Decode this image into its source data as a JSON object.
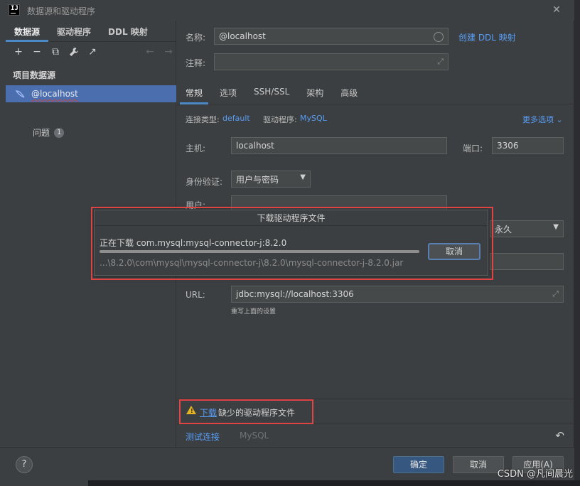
{
  "window": {
    "logo": "IJ",
    "title": "数据源和驱动程序",
    "close": "✕"
  },
  "left": {
    "tabs": [
      {
        "label": "数据源",
        "active": true
      },
      {
        "label": "驱动程序",
        "active": false
      },
      {
        "label": "DDL 映射",
        "active": false
      }
    ],
    "toolbar": {
      "add": "+",
      "remove": "−",
      "copy": "⧉",
      "settings": "🔧",
      "export": "↗",
      "back": "←",
      "forward": "→"
    },
    "group_label": "项目数据源",
    "datasource": "@localhost",
    "issues_label": "问题",
    "issues_count": "1"
  },
  "right": {
    "name_label": "名称:",
    "name_value": "@localhost",
    "create_ddl_link": "创建 DDL 映射",
    "comment_label": "注释:",
    "comment_value": "",
    "tabs": [
      {
        "label": "常规",
        "active": true
      },
      {
        "label": "选项",
        "active": false
      },
      {
        "label": "SSH/SSL",
        "active": false
      },
      {
        "label": "架构",
        "active": false
      },
      {
        "label": "高级",
        "active": false
      }
    ],
    "conn_type_label": "连接类型:",
    "conn_type_value": "default",
    "driver_label": "驱动程序:",
    "driver_value": "MySQL",
    "more_options": "更多选项",
    "host_label": "主机:",
    "host_value": "localhost",
    "port_label": "端口:",
    "port_value": "3306",
    "auth_label": "身份验证:",
    "auth_value": "用户与密码",
    "user_label": "用户:",
    "save_value": "永久",
    "url_label": "URL:",
    "url_value": "jdbc:mysql://localhost:3306",
    "url_hint": "重写上面的设置",
    "warning_link": "下载",
    "warning_text": "缺少的驱动程序文件",
    "test_connection": "测试连接",
    "test_driver": "MySQL",
    "undo": "↶"
  },
  "modal": {
    "title": "下载驱动程序文件",
    "status": "正在下载 com.mysql:mysql-connector-j:8.2.0",
    "progress": 1.0,
    "path": "...\\8.2.0\\com\\mysql\\mysql-connector-j\\8.2.0\\mysql-connector-j-8.2.0.jar",
    "cancel": "取消"
  },
  "footer": {
    "help": "?",
    "ok": "确定",
    "cancel": "取消",
    "apply": "应用(A)"
  },
  "watermark": "CSDN @凡间晨光",
  "colors": {
    "accent": "#4a88c7",
    "link": "#589df6",
    "highlight_red": "#e04343",
    "selection": "#4b6eaf",
    "warning": "#e6b422"
  }
}
